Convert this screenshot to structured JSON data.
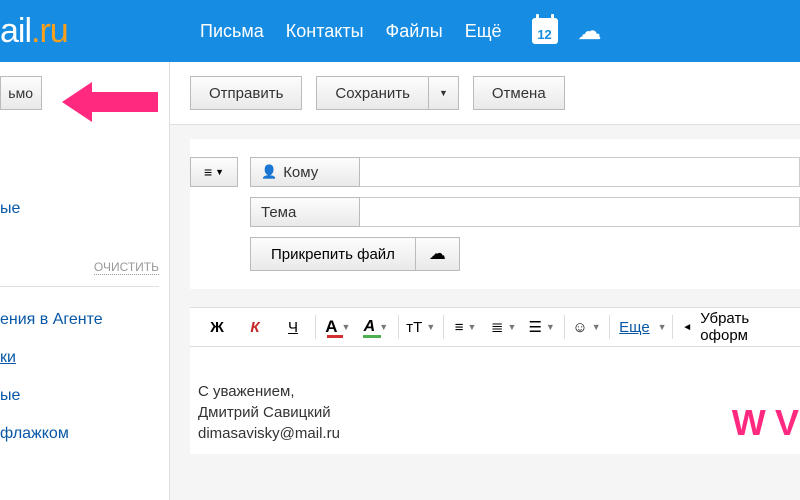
{
  "header": {
    "logo_prefix": "ail",
    "logo_dot": ".",
    "logo_suffix": "ru",
    "nav": [
      "Письма",
      "Контакты",
      "Файлы",
      "Ещё"
    ],
    "calendar_day": "12"
  },
  "sidebar": {
    "compose_btn": "ьмо",
    "links_top": [
      "ые"
    ],
    "clear": "ОЧИСТИТЬ",
    "links_bottom": [
      "ения в Агенте",
      "ки",
      "ые",
      "флажком"
    ]
  },
  "toolbar": {
    "send": "Отправить",
    "save": "Сохранить",
    "cancel": "Отмена"
  },
  "compose": {
    "to_label": "Кому",
    "subject_label": "Тема",
    "attach": "Прикрепить файл"
  },
  "format": {
    "bold": "Ж",
    "italic": "К",
    "underline": "Ч",
    "color": "A",
    "highlight": "A",
    "size": "тT",
    "more": "Еще",
    "clean": "Убрать оформ"
  },
  "signature": {
    "l1": "С уважением,",
    "l2": "Дмитрий Савицкий",
    "l3": "dimasavisky@mail.ru"
  },
  "watermark": "W V"
}
